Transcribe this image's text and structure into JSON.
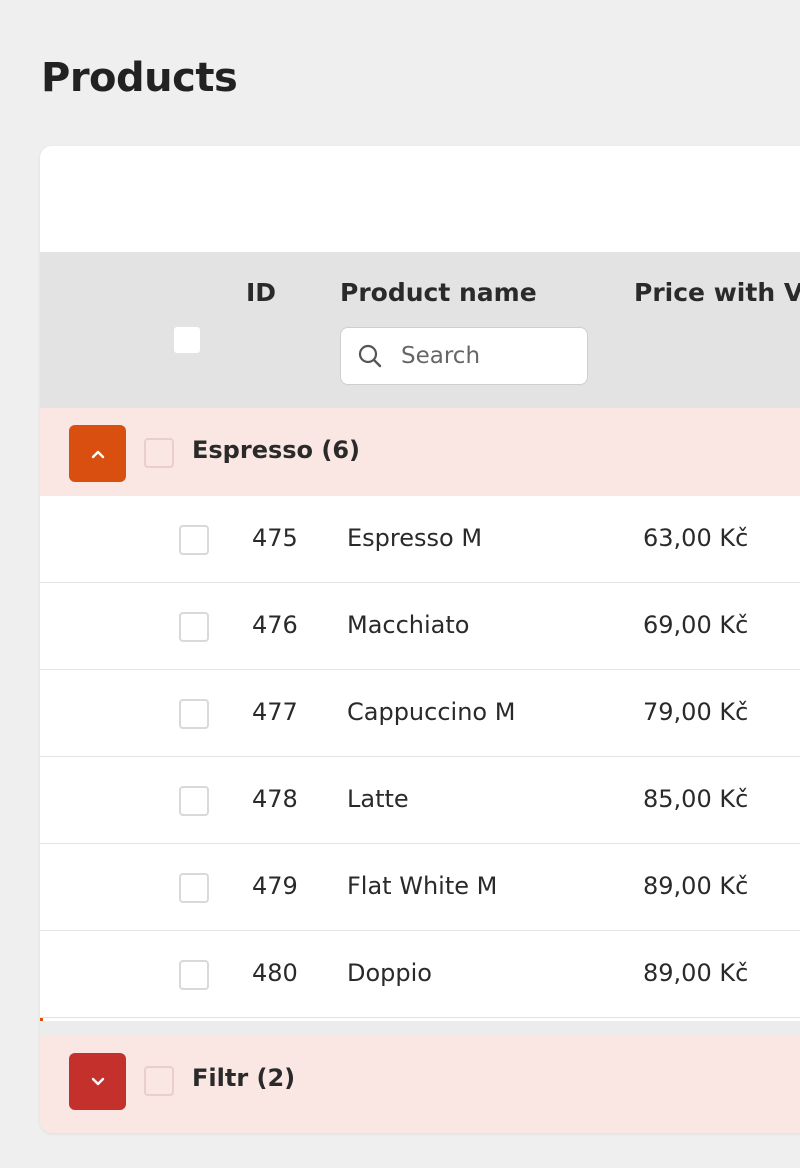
{
  "page": {
    "title": "Products"
  },
  "table": {
    "columns": {
      "id": "ID",
      "name": "Product name",
      "price": "Price with VA"
    },
    "search": {
      "placeholder": "Search"
    }
  },
  "groups": [
    {
      "label": "Espresso (6)",
      "expanded": true,
      "toggle_color": "#d94f0f",
      "rows": [
        {
          "id": "475",
          "name": "Espresso M",
          "price": "63,00 Kč"
        },
        {
          "id": "476",
          "name": "Macchiato",
          "price": "69,00 Kč"
        },
        {
          "id": "477",
          "name": "Cappuccino M",
          "price": "79,00 Kč"
        },
        {
          "id": "478",
          "name": "Latte",
          "price": "85,00 Kč"
        },
        {
          "id": "479",
          "name": "Flat White M",
          "price": "89,00 Kč"
        },
        {
          "id": "480",
          "name": "Doppio",
          "price": "89,00 Kč"
        }
      ]
    },
    {
      "label": "Filtr (2)",
      "expanded": false,
      "toggle_color": "#c4302b",
      "rows": []
    }
  ],
  "colors": {
    "page_background": "#efefef",
    "header_background": "#e3e3e3",
    "group_background": "#fae6e3",
    "espresso_accent": "#d94f0f",
    "filtr_accent": "#c4302b"
  },
  "icons": {
    "search": "search-icon",
    "collapse": "chevron-up-icon",
    "expand": "chevron-down-icon"
  }
}
